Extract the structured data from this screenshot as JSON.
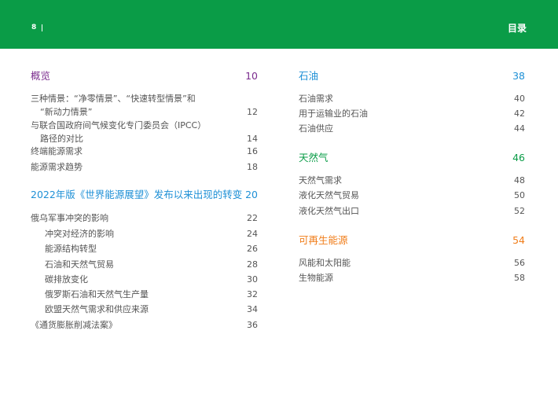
{
  "header": {
    "page_number": "8",
    "title": "目录",
    "bg_color": "#0a9c47"
  },
  "colors": {
    "purple": "#7b2d8e",
    "blue": "#1e90d6",
    "green": "#0a9c47",
    "orange": "#f07d1a",
    "body": "#555555"
  },
  "left": {
    "s1": {
      "title": "概览",
      "page": "10"
    },
    "s1_items": [
      {
        "line1": "三种情景：“净零情景”、“快速转型情景”和",
        "line2": "“新动力情景”",
        "page": "12"
      },
      {
        "line1": "与联合国政府间气候变化专门委员会（IPCC）",
        "line2": "路径的对比",
        "page": "14"
      },
      {
        "text": "终端能源需求",
        "page": "16"
      },
      {
        "text": "能源需求趋势",
        "page": "18"
      }
    ],
    "s2": {
      "title": "2022年版《世界能源展望》发布以来出现的转变",
      "page": "20"
    },
    "s2_items": [
      {
        "text": "俄乌军事冲突的影响",
        "page": "22"
      },
      {
        "text": "冲突对经济的影响",
        "page": "24"
      },
      {
        "text": "能源结构转型",
        "page": "26"
      },
      {
        "text": "石油和天然气贸易",
        "page": "28"
      },
      {
        "text": "碳排放变化",
        "page": "30"
      },
      {
        "text": "俄罗斯石油和天然气生产量",
        "page": "32"
      },
      {
        "text": "欧盟天然气需求和供应来源",
        "page": "34"
      },
      {
        "text": "《通货膨胀削减法案》",
        "page": "36"
      }
    ]
  },
  "right": {
    "s1": {
      "title": "石油",
      "page": "38"
    },
    "s1_items": [
      {
        "text": "石油需求",
        "page": "40"
      },
      {
        "text": "用于运输业的石油",
        "page": "42"
      },
      {
        "text": "石油供应",
        "page": "44"
      }
    ],
    "s2": {
      "title": "天然气",
      "page": "46"
    },
    "s2_items": [
      {
        "text": "天然气需求",
        "page": "48"
      },
      {
        "text": "液化天然气贸易",
        "page": "50"
      },
      {
        "text": "液化天然气出口",
        "page": "52"
      }
    ],
    "s3": {
      "title": "可再生能源",
      "page": "54"
    },
    "s3_items": [
      {
        "text": "风能和太阳能",
        "page": "56"
      },
      {
        "text": "生物能源",
        "page": "58"
      }
    ]
  }
}
